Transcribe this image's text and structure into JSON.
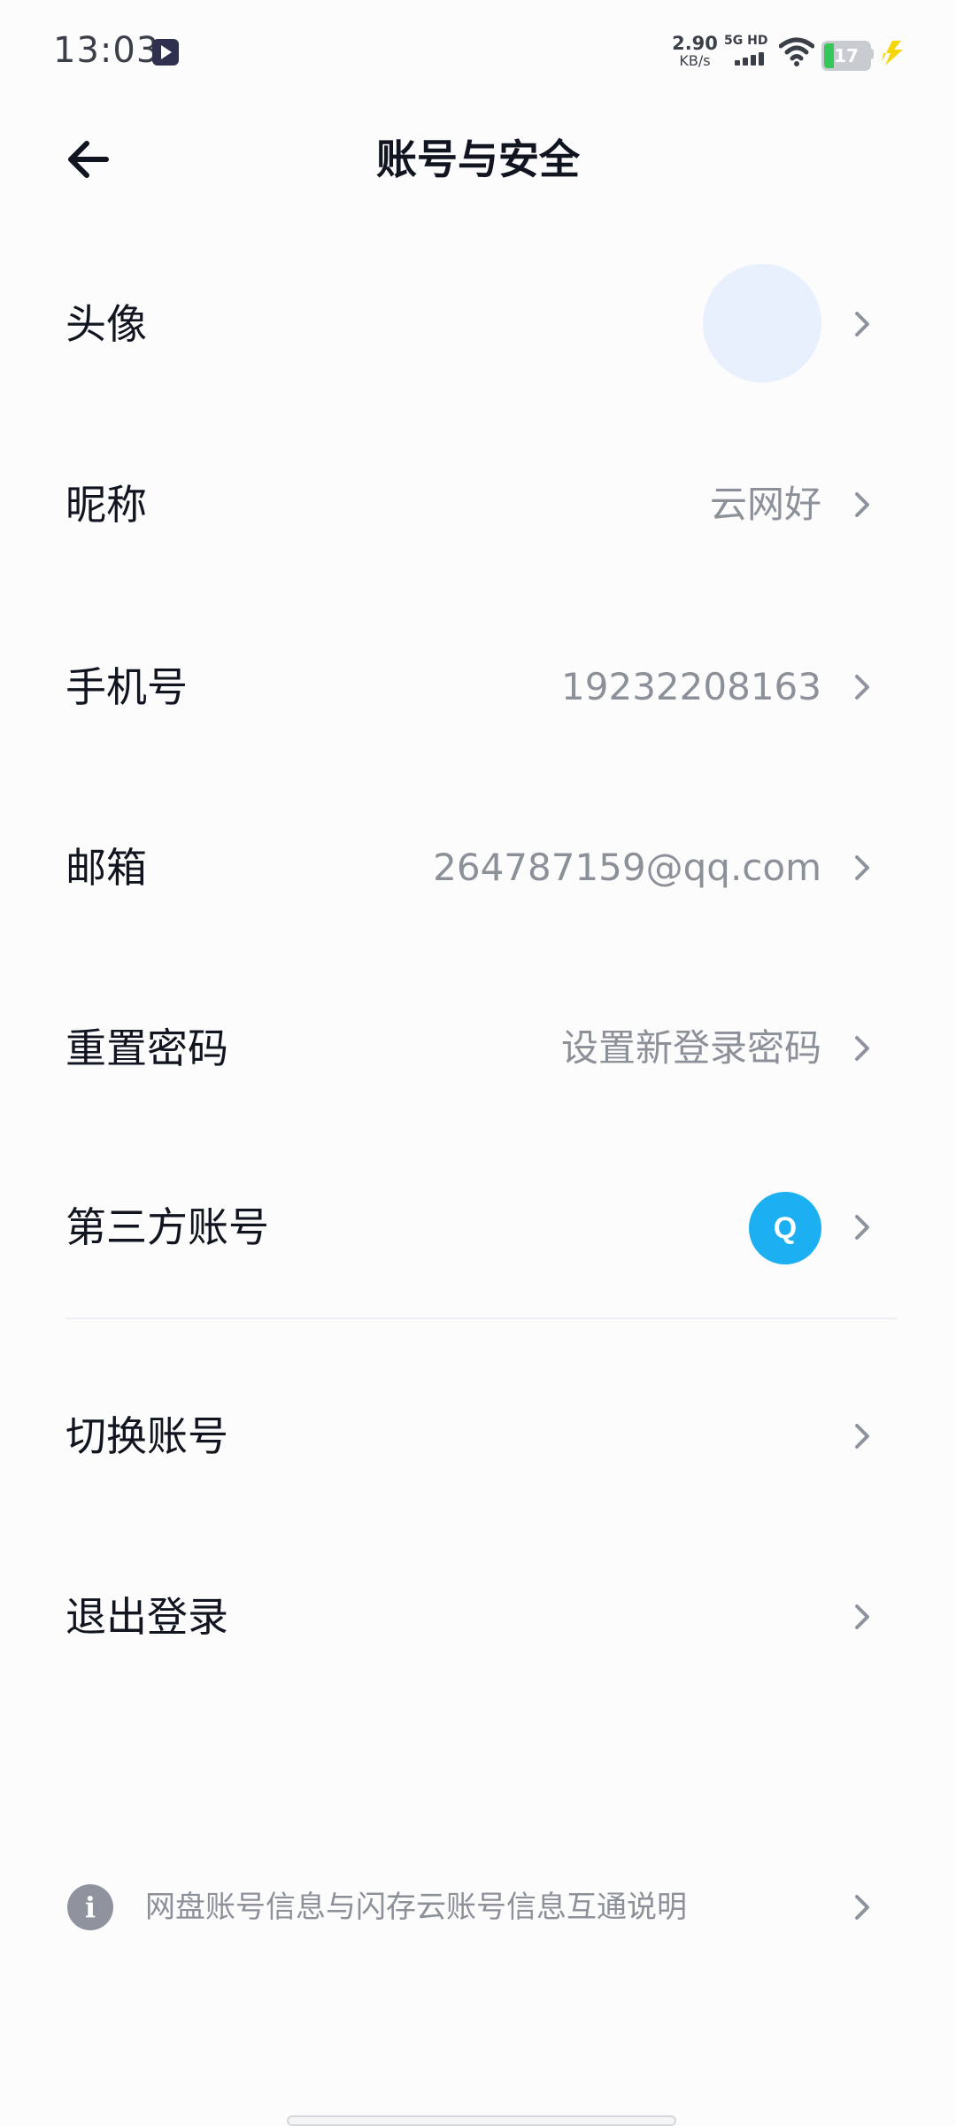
{
  "status_bar": {
    "time": "13:03",
    "speed_value": "2.90",
    "speed_unit": "KB/s",
    "network_type": "5G HD",
    "battery": "17",
    "icons": [
      "app-icon",
      "signal-icon",
      "wifi-icon",
      "battery-icon",
      "charging-icon"
    ]
  },
  "header": {
    "title": "账号与安全",
    "back_icon": "back-arrow-icon"
  },
  "rows": [
    {
      "label": "头像",
      "value": ""
    },
    {
      "label": "昵称",
      "value": "云网好"
    },
    {
      "label": "手机号",
      "value": "19232208163"
    },
    {
      "label": "邮箱",
      "value": "264787159@qq.com"
    },
    {
      "label": "重置密码",
      "value": "设置新登录密码"
    },
    {
      "label": "第三方账号",
      "value": "",
      "badge": "Q"
    }
  ],
  "actions": [
    {
      "label": "切换账号"
    },
    {
      "label": "退出登录"
    }
  ],
  "footer": {
    "info_icon_glyph": "i",
    "info_text": "网盘账号信息与闪存云账号信息互通说明"
  },
  "colors": {
    "qq_badge": "#1cb0f2",
    "avatar_placeholder": "#e8f0fd",
    "secondary_text": "#8c9099"
  }
}
